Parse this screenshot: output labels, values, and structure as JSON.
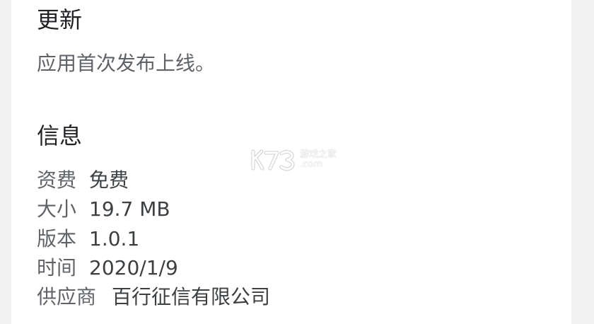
{
  "update": {
    "title": "更新",
    "text": "应用首次发布上线。"
  },
  "info": {
    "title": "信息",
    "rows": [
      {
        "label": "资费",
        "value": "免费"
      },
      {
        "label": "大小",
        "value": "19.7 MB"
      },
      {
        "label": "版本",
        "value": "1.0.1"
      },
      {
        "label": "时间",
        "value": "2020/1/9"
      },
      {
        "label": "供应商",
        "value": "百行征信有限公司"
      }
    ]
  },
  "watermark": {
    "brand": "K73",
    "text": "游戏之家",
    "url": ".com"
  },
  "colors": {
    "background": "#f2f2f2",
    "card": "#ffffff",
    "title": "#202124",
    "label": "#5f6368",
    "value": "#3c4043"
  }
}
